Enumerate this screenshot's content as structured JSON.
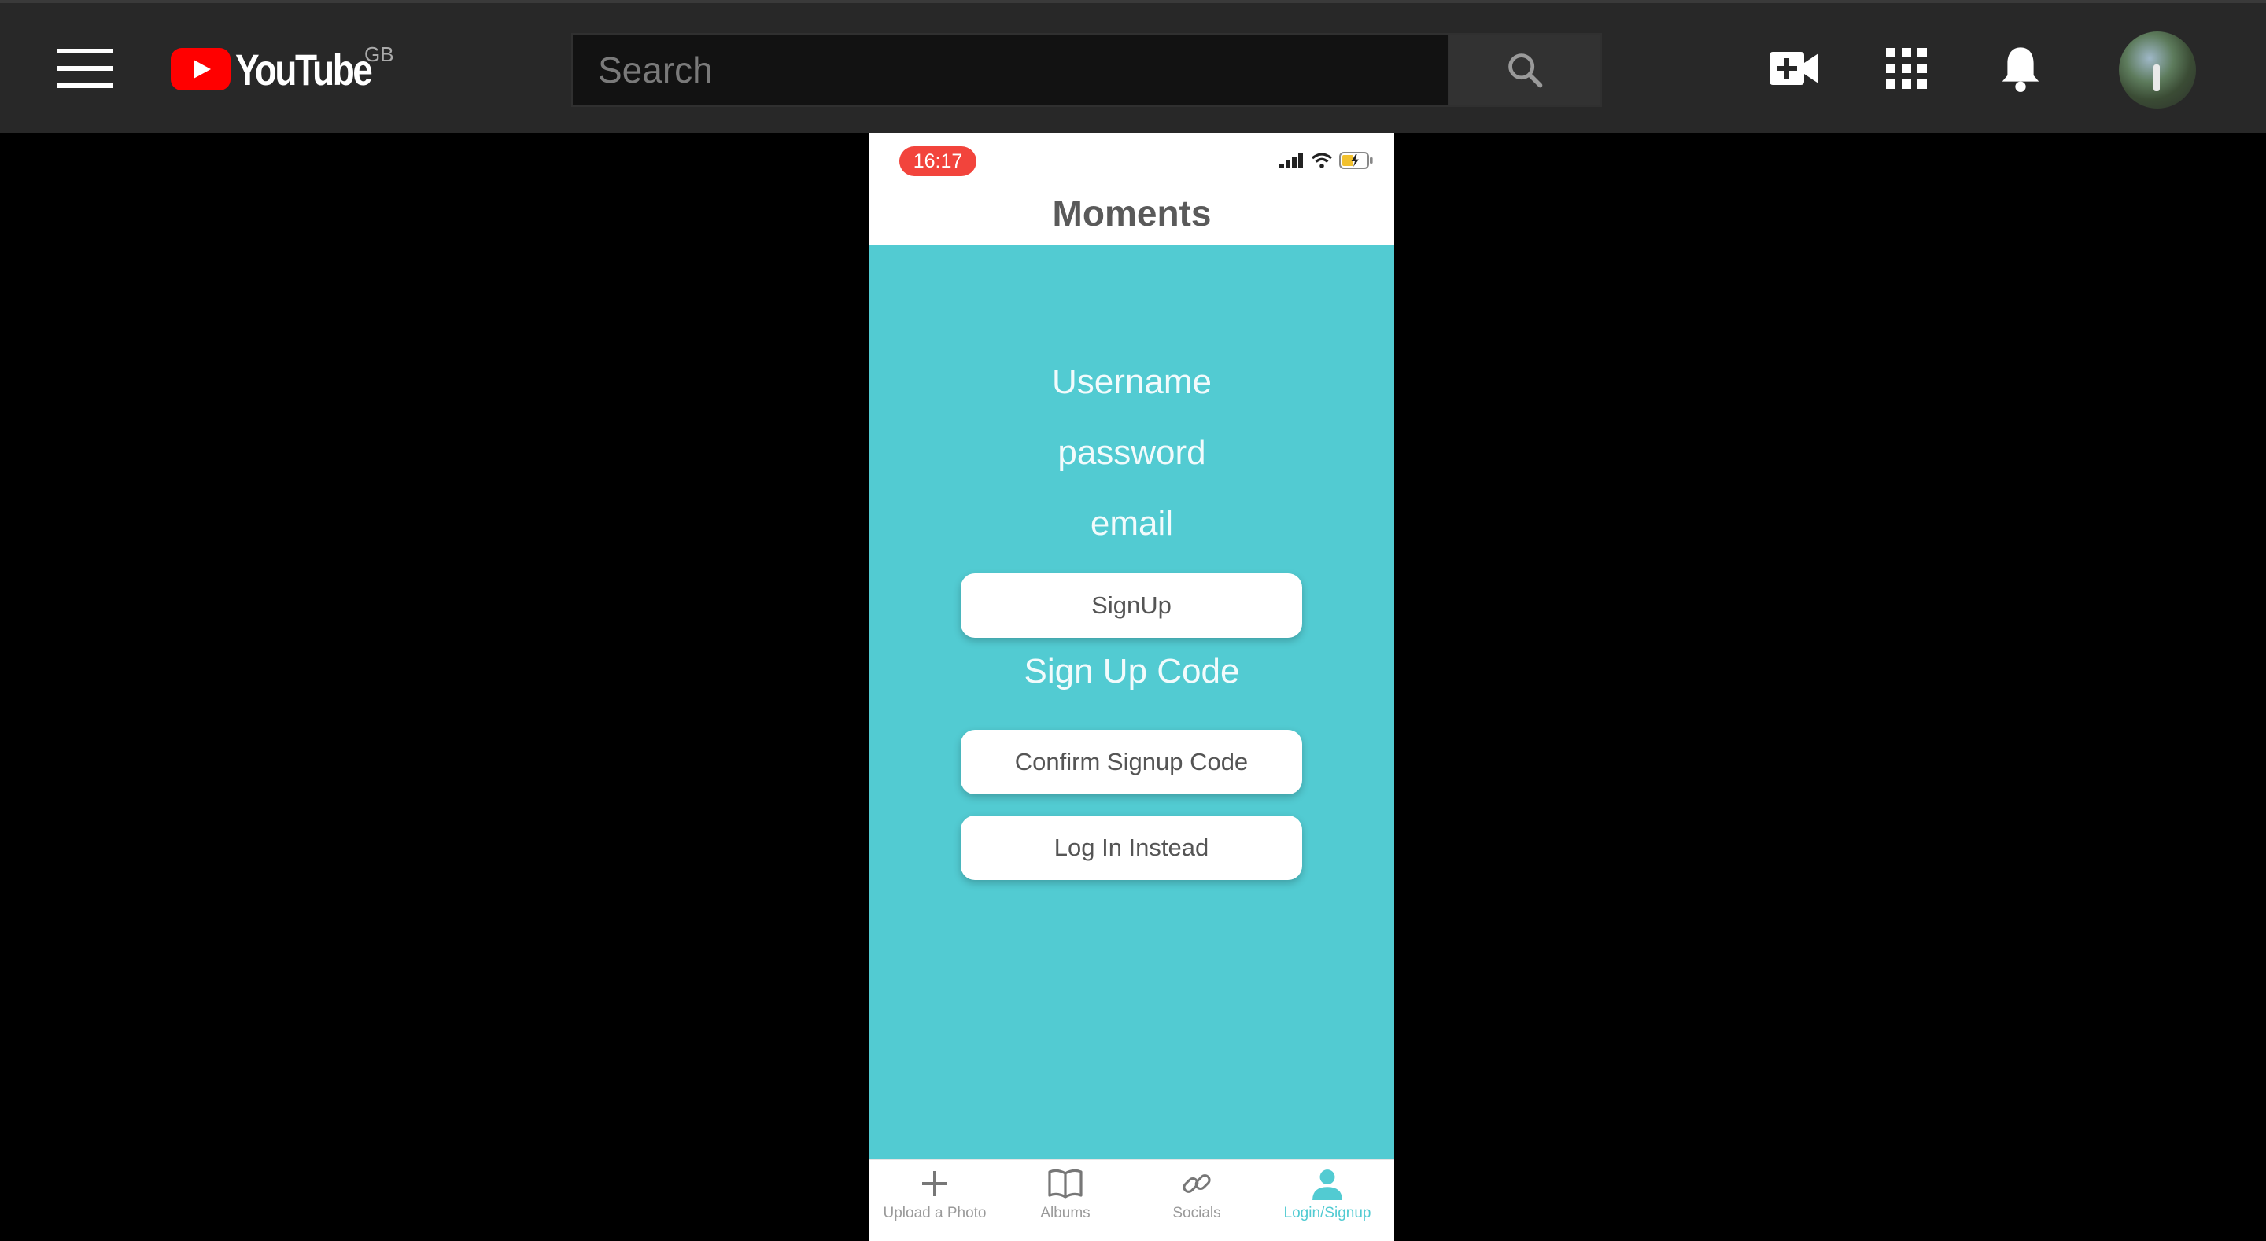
{
  "header": {
    "logo_text": "YouTube",
    "region": "GB",
    "search_placeholder": "Search"
  },
  "phone": {
    "status_time": "16:17",
    "app_title": "Moments",
    "fields": {
      "username": "Username",
      "password": "password",
      "email": "email",
      "signup_code": "Sign Up Code"
    },
    "buttons": {
      "signup": "SignUp",
      "confirm": "Confirm Signup Code",
      "login": "Log In Instead"
    },
    "tabs": [
      {
        "label": "Upload a Photo",
        "icon": "plus-icon"
      },
      {
        "label": "Albums",
        "icon": "book-icon"
      },
      {
        "label": "Socials",
        "icon": "link-icon"
      },
      {
        "label": "Login/Signup",
        "icon": "user-icon",
        "active": true
      }
    ]
  },
  "colors": {
    "teal": "#52cbd2",
    "youtube_red": "#ff0000",
    "status_pill": "#f2443c",
    "topbar": "#282828"
  }
}
